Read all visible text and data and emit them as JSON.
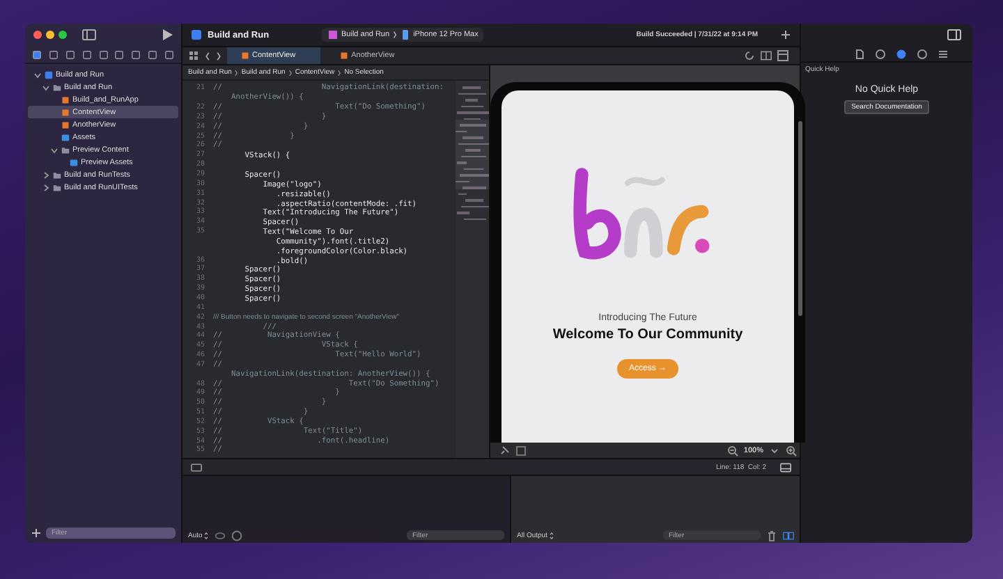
{
  "toolbar": {
    "project_title": "Build and Run",
    "scheme": "Build and Run",
    "destination": "iPhone 12 Pro Max",
    "status": "Build Succeeded | 7/31/22 at 9:14 PM"
  },
  "navigator": {
    "items": [
      {
        "label": "Build and Run",
        "kind": "project",
        "expanded": true,
        "selected": false,
        "children": [
          {
            "label": "Build and Run",
            "kind": "folder",
            "expanded": true,
            "selected": false,
            "children": [
              {
                "label": "Build_and_RunApp",
                "kind": "swift",
                "selected": false
              },
              {
                "label": "ContentView",
                "kind": "swift",
                "selected": true
              },
              {
                "label": "AnotherView",
                "kind": "swift",
                "selected": false
              },
              {
                "label": "Assets",
                "kind": "assets",
                "selected": false
              },
              {
                "label": "Preview Content",
                "kind": "folder",
                "expanded": true,
                "selected": false,
                "children": [
                  {
                    "label": "Preview Assets",
                    "kind": "assets",
                    "selected": false
                  }
                ]
              }
            ]
          },
          {
            "label": "Build and RunTests",
            "kind": "folder",
            "expanded": false,
            "selected": false
          },
          {
            "label": "Build and RunUITests",
            "kind": "folder",
            "expanded": false,
            "selected": false
          }
        ]
      }
    ],
    "filter_placeholder": "Filter"
  },
  "tabs": [
    {
      "label": "ContentView",
      "selected": true
    },
    {
      "label": "AnotherView",
      "selected": false
    }
  ],
  "breadcrumb": [
    "Build and Run",
    "Build and Run",
    "ContentView",
    "No Selection"
  ],
  "code": [
    {
      "num": "21",
      "kind": "comment",
      "text": "//                      NavigationLink(destination:"
    },
    {
      "kind": "comment",
      "text": "    AnotherView()) {"
    },
    {
      "num": "22",
      "kind": "comment",
      "text": "//                         Text(\"Do Something\")"
    },
    {
      "num": "23",
      "kind": "comment",
      "text": "//                      }"
    },
    {
      "num": "24",
      "kind": "comment",
      "text": "//                  }"
    },
    {
      "num": "25",
      "kind": "comment",
      "text": "//               }"
    },
    {
      "num": "26",
      "kind": "comment",
      "text": "//"
    },
    {
      "num": "27",
      "kind": "code",
      "text": "       VStack() {"
    },
    {
      "num": "28"
    },
    {
      "num": "29",
      "kind": "code",
      "text": "       Spacer()"
    },
    {
      "num": "30",
      "kind": "code",
      "text": "           Image(\"logo\")"
    },
    {
      "num": "31",
      "kind": "code",
      "text": "              .resizable()"
    },
    {
      "num": "32",
      "kind": "code",
      "text": "              .aspectRatio(contentMode: .fit)"
    },
    {
      "num": "33",
      "kind": "code",
      "text": "           Text(\"Introducing The Future\")"
    },
    {
      "num": "34",
      "kind": "code",
      "text": "           Spacer()"
    },
    {
      "num": "35",
      "kind": "code",
      "text": "           Text(\"Welcome To Our"
    },
    {
      "kind": "code",
      "text": "              Community\").font(.title2)"
    },
    {
      "kind": "code",
      "text": "              .foregroundColor(Color.black)"
    },
    {
      "num": "36",
      "kind": "code",
      "text": "              .bold()"
    },
    {
      "num": "37",
      "kind": "code",
      "text": "       Spacer()"
    },
    {
      "num": "38",
      "kind": "code",
      "text": "       Spacer()"
    },
    {
      "num": "39",
      "kind": "code",
      "text": "       Spacer()"
    },
    {
      "num": "40",
      "kind": "code",
      "text": "       Spacer()"
    },
    {
      "num": "41"
    },
    {
      "num": "42",
      "kind": "doc",
      "text": "/// Button needs to navigate to second screen \"AnotherView\""
    },
    {
      "num": "43",
      "kind": "comment",
      "text": "           ///"
    },
    {
      "num": "44",
      "kind": "comment",
      "text": "//          NavigationView {"
    },
    {
      "num": "45",
      "kind": "comment",
      "text": "//                      VStack {"
    },
    {
      "num": "46",
      "kind": "comment",
      "text": "//                         Text(\"Hello World\")"
    },
    {
      "num": "47",
      "kind": "comment",
      "text": "//"
    },
    {
      "kind": "comment",
      "text": "    NavigationLink(destination: AnotherView()) {"
    },
    {
      "num": "48",
      "kind": "comment",
      "text": "//                            Text(\"Do Something\")"
    },
    {
      "num": "49",
      "kind": "comment",
      "text": "//                         }"
    },
    {
      "num": "50",
      "kind": "comment",
      "text": "//                      }"
    },
    {
      "num": "51",
      "kind": "comment",
      "text": "//                  }"
    },
    {
      "num": "52",
      "kind": "comment",
      "text": "//          VStack {"
    },
    {
      "num": "53",
      "kind": "comment",
      "text": "//                  Text(\"Title\")"
    },
    {
      "num": "54",
      "kind": "comment",
      "text": "//                     .font(.headline)"
    },
    {
      "num": "55",
      "kind": "comment",
      "text": "//"
    }
  ],
  "preview": {
    "subtitle": "Introducing The Future",
    "title": "Welcome To Our Community",
    "button": "Access →",
    "zoom": "100%"
  },
  "status_line": "Line: 118  Col: 2",
  "debug": {
    "scope": "Auto",
    "filter_placeholder": "Filter",
    "output": "All Output",
    "output_filter_placeholder": "Filter"
  },
  "inspector": {
    "heading": "Quick Help",
    "empty": "No Quick Help",
    "button": "Search Documentation"
  }
}
